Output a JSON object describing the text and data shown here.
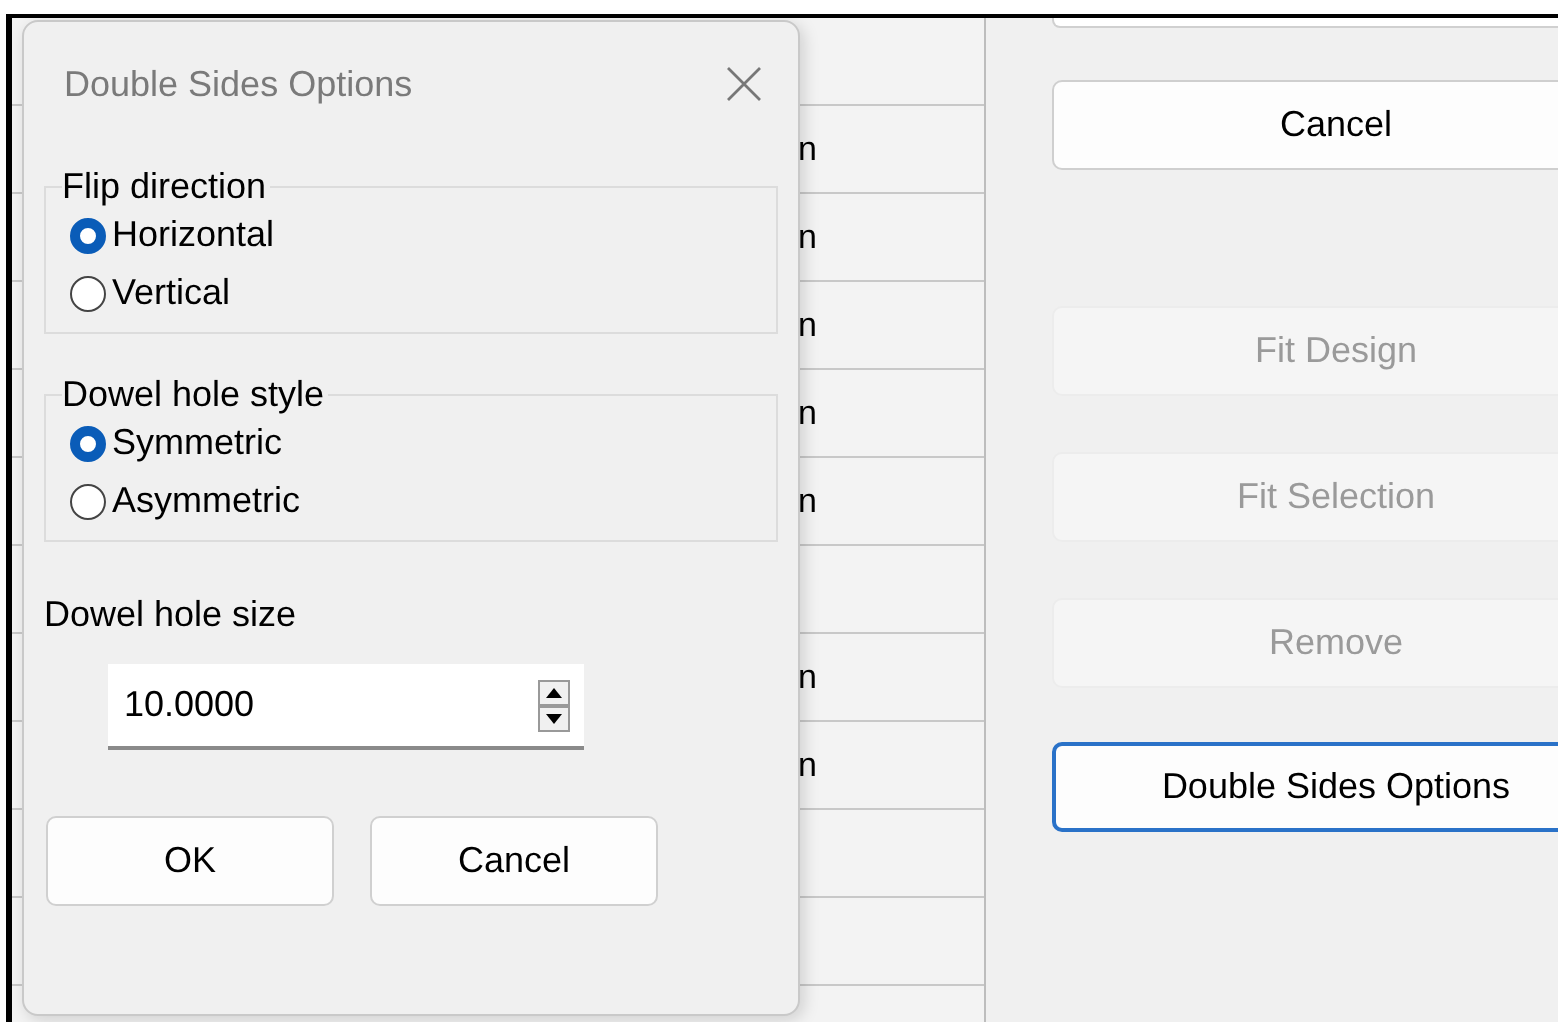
{
  "background_table": {
    "rows": [
      {},
      {
        "cell": "n"
      },
      {
        "cell": "n"
      },
      {
        "cell": "n"
      },
      {
        "cell": "n"
      },
      {
        "cell": "n"
      },
      {},
      {
        "cell": "n"
      },
      {
        "cell": "n"
      },
      {},
      {}
    ]
  },
  "side_buttons": [
    {
      "label": "Cancel",
      "disabled": false,
      "focused": false
    },
    {
      "label": "Fit Design",
      "disabled": true,
      "focused": false
    },
    {
      "label": "Fit Selection",
      "disabled": true,
      "focused": false
    },
    {
      "label": "Remove",
      "disabled": true,
      "focused": false
    },
    {
      "label": "Double Sides Options",
      "disabled": false,
      "focused": true
    }
  ],
  "dialog": {
    "title": "Double Sides Options",
    "groups": [
      {
        "legend": "Flip direction",
        "options": [
          {
            "label": "Horizontal",
            "selected": true
          },
          {
            "label": "Vertical",
            "selected": false
          }
        ]
      },
      {
        "legend": "Dowel hole style",
        "options": [
          {
            "label": "Symmetric",
            "selected": true
          },
          {
            "label": "Asymmetric",
            "selected": false
          }
        ]
      }
    ],
    "size_field": {
      "label": "Dowel hole size",
      "value": "10.0000"
    },
    "buttons": [
      "OK",
      "Cancel"
    ]
  }
}
